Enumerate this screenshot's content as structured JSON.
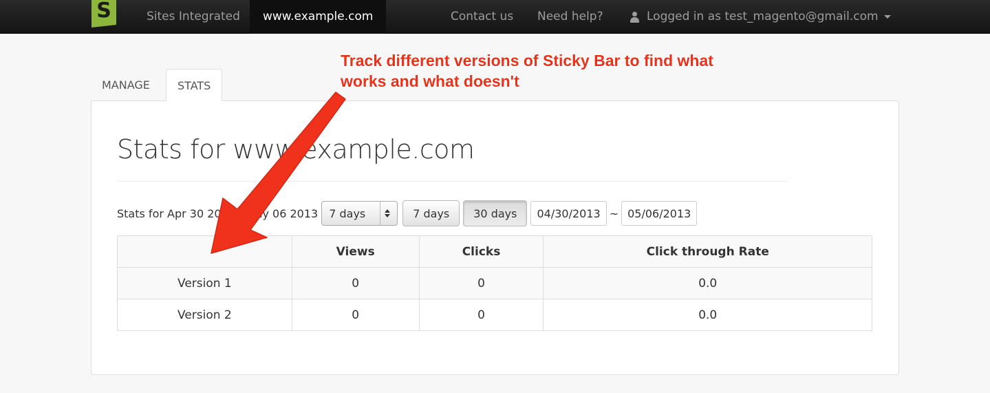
{
  "navbar": {
    "logo_letter": "S",
    "links": {
      "sites_integrated": "Sites Integrated",
      "current_site": "www.example.com",
      "contact": "Contact us",
      "help": "Need help?"
    },
    "user_label": "Logged in as test_magento@gmail.com"
  },
  "tabs": {
    "manage": "MANAGE",
    "stats": "STATS"
  },
  "stats": {
    "title": "Stats for www.example.com",
    "range_label": "Stats for Apr 30 2013 - May 06 2013",
    "period_select": "7 days",
    "btn_7_days": "7 days",
    "btn_30_days": "30 days",
    "date_from": "04/30/2013",
    "date_separator": "~",
    "date_to": "05/06/2013"
  },
  "table": {
    "headers": [
      "",
      "Views",
      "Clicks",
      "Click through Rate"
    ],
    "rows": [
      [
        "Version 1",
        "0",
        "0",
        "0.0"
      ],
      [
        "Version 2",
        "0",
        "0",
        "0.0"
      ]
    ]
  },
  "annotation": {
    "line1": "Track different versions of Sticky Bar to find what",
    "line2": "works and what doesn't",
    "color": "#e8321b"
  }
}
